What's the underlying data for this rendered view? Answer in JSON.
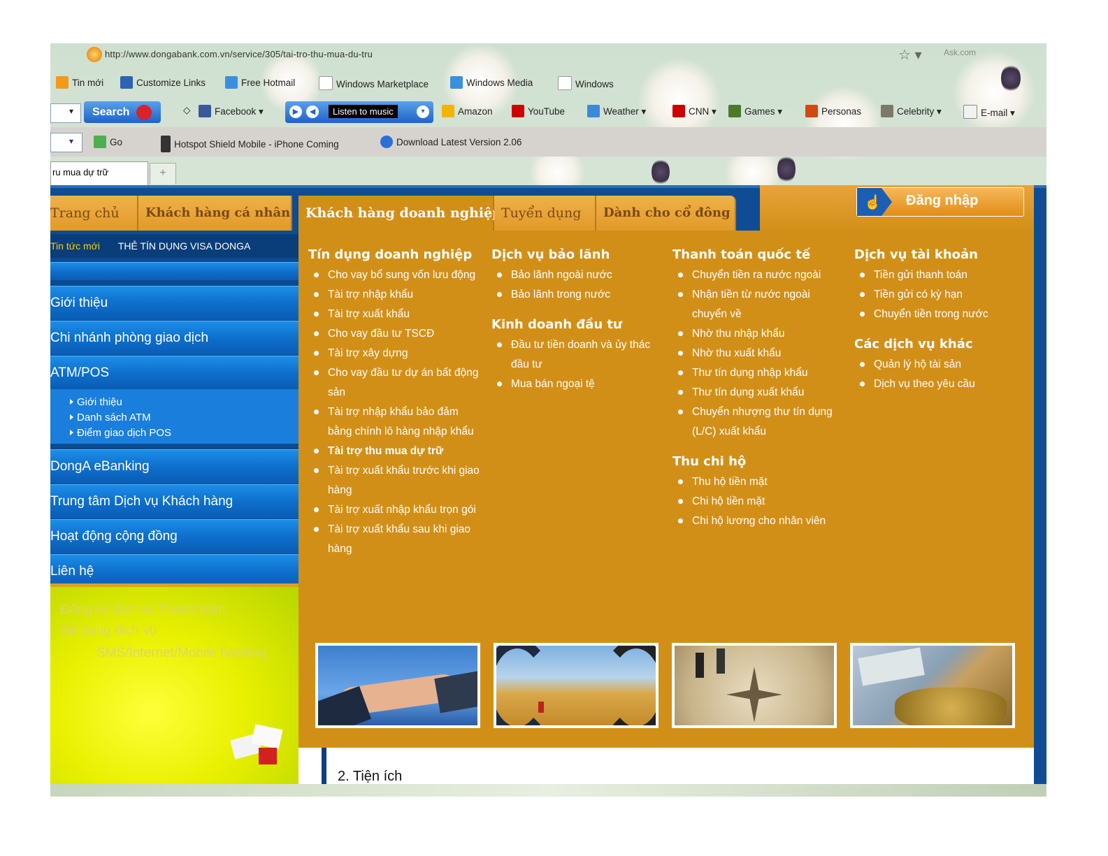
{
  "browser": {
    "url": "http://www.dongabank.com.vn/service/305/tai-tro-thu-mua-du-tru",
    "search_box_placeholder": "Ask.com",
    "links": [
      "Tin mới",
      "Customize Links",
      "Free Hotmail",
      "Windows Marketplace",
      "Windows Media",
      "Windows"
    ],
    "toolbar": {
      "search_label": "Search",
      "items": [
        "Facebook ▾",
        "Listen to music",
        "Amazon",
        "YouTube",
        "Weather ▾",
        "CNN ▾",
        "Games ▾",
        "Personas",
        "Celebrity ▾",
        "E-mail ▾"
      ]
    },
    "gray_row": [
      "Go",
      "Hotspot Shield Mobile - iPhone Coming",
      "Download Latest Version 2.06"
    ],
    "tab_title": "ru mua dự trữ",
    "new_tab": "+"
  },
  "nav": {
    "items": [
      "Trang chủ",
      "Khách hàng cá nhân",
      "Khách hàng doanh nghiệp",
      "Tuyển dụng",
      "Dành cho cổ đông"
    ],
    "login": "Đăng nhập"
  },
  "sidebar": {
    "ticker_label": "Tin tức mới",
    "ticker_text": "THẺ TÍN DỤNG VISA DONGA",
    "items": [
      "Giới thiệu",
      "Chi nhánh phòng giao dịch",
      "ATM/POS",
      "DongA eBanking",
      "Trung tâm Dịch vụ Khách hàng",
      "Hoạt động cộng đồng",
      "Liên hệ"
    ],
    "sub_items": [
      "Giới thiệu",
      "Danh sách ATM",
      "Điểm giao dịch POS"
    ],
    "promo": [
      "Đăng ký dịch vụ Thanh toán",
      "Sử dụng dịch vụ",
      "SMS/Internet/Mobile banking"
    ]
  },
  "mega": {
    "col1": {
      "title": "Tín dụng doanh nghiệp",
      "items": [
        "Cho vay bổ sung vốn lưu động",
        "Tài trợ nhập khẩu",
        "Tài trợ xuất khẩu",
        "Cho vay đầu tư TSCĐ",
        "Tài trợ xây dựng",
        "Cho vay đầu tư dự án bất động sản",
        "Tài trợ nhập khẩu bảo đảm bằng chính lô hàng nhập khẩu",
        "Tài trợ thu mua dự trữ",
        "Tài trợ xuất khẩu trước khi giao hàng",
        "Tài trợ xuất nhập khẩu trọn gói",
        "Tài trợ xuất khẩu sau khi giao hàng"
      ]
    },
    "col2": {
      "title": "Dịch vụ bảo lãnh",
      "items": [
        "Bảo lãnh ngoài nước",
        "Bảo lãnh trong nước"
      ],
      "title2": "Kinh doanh đầu tư",
      "items2": [
        "Đầu tư tiền doanh và ủy thác đầu tư",
        "Mua bán ngoại tệ"
      ]
    },
    "col3": {
      "title": "Thanh toán quốc tế",
      "items": [
        "Chuyển tiền ra nước ngoài",
        "Nhận tiền từ nước ngoài chuyển về",
        "Nhờ thu nhập khẩu",
        "Nhờ thu xuất khẩu",
        "Thư tín dụng nhập khẩu",
        "Thư tín dụng xuất khẩu",
        "Chuyển nhượng thư tín dụng (L/C) xuất khẩu"
      ],
      "title2": "Thu chi hộ",
      "items2": [
        "Thu hộ tiền mặt",
        "Chi hộ tiền mặt",
        "Chi hộ lương cho nhân viên"
      ]
    },
    "col4": {
      "title": "Dịch vụ tài khoản",
      "items": [
        "Tiền gửi thanh toán",
        "Tiền gửi có kỳ hạn",
        "Chuyển tiền trong nước"
      ],
      "title2": "Các dịch vụ khác",
      "items2": [
        "Quản lý hộ tài sản",
        "Dịch vụ theo yêu cầu"
      ]
    }
  },
  "content": {
    "heading": "2. Tiện ích"
  }
}
